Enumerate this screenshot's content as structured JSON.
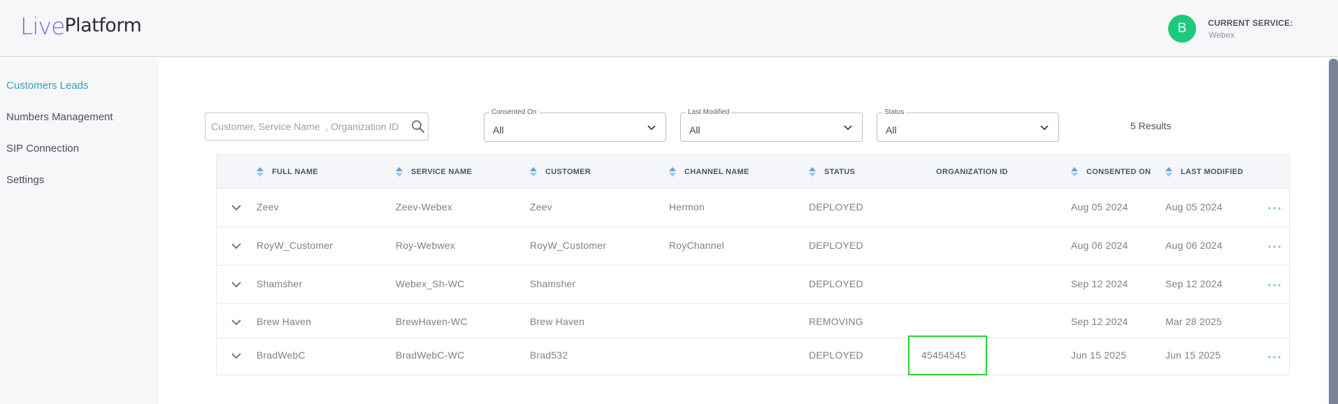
{
  "header": {
    "logo_live": "Live",
    "logo_platform": "Platform",
    "avatar_letter": "B",
    "service_label": "CURRENT SERVICE:",
    "service_value": "Webex"
  },
  "sidebar": {
    "items": [
      {
        "label": "Customers Leads",
        "active": true
      },
      {
        "label": "Numbers Management"
      },
      {
        "label": "SIP Connection"
      },
      {
        "label": "Settings"
      }
    ]
  },
  "filters": {
    "search_placeholder": "Customer, Service Name  , Organization ID",
    "consented_on": {
      "label": "Consented On",
      "value": "All"
    },
    "last_modified": {
      "label": "Last Modified",
      "value": "All"
    },
    "status": {
      "label": "Status",
      "value": "All"
    },
    "results": "5 Results"
  },
  "table": {
    "columns": [
      "FULL NAME",
      "SERVICE NAME",
      "CUSTOMER",
      "CHANNEL NAME",
      "STATUS",
      "ORGANIZATION ID",
      "CONSENTED ON",
      "LAST MODIFIED"
    ],
    "rows": [
      {
        "full_name": "Zeev",
        "service_name": "Zeev-Webex",
        "customer": "Zeev",
        "channel_name": "Hermon",
        "status": "DEPLOYED",
        "organization_id": "",
        "consented_on": "Aug 05 2024",
        "last_modified": "Aug 05 2024"
      },
      {
        "full_name": "RoyW_Customer",
        "service_name": "Roy-Webwex",
        "customer": "RoyW_Customer",
        "channel_name": "RoyChannel",
        "status": "DEPLOYED",
        "organization_id": "",
        "consented_on": "Aug 06 2024",
        "last_modified": "Aug 06 2024"
      },
      {
        "full_name": "Shamsher",
        "service_name": "Webex_Sh-WC",
        "customer": "Shamsher",
        "channel_name": "",
        "status": "DEPLOYED",
        "organization_id": "",
        "consented_on": "Sep 12 2024",
        "last_modified": "Sep 12 2024"
      },
      {
        "full_name": "Brew Haven",
        "service_name": "BrewHaven-WC",
        "customer": "Brew Haven",
        "channel_name": "",
        "status": "REMOVING",
        "organization_id": "",
        "consented_on": "Sep 12 2024",
        "last_modified": "Mar 28 2025"
      },
      {
        "full_name": "BradWebC",
        "service_name": "BradWebC-WC",
        "customer": "Brad532",
        "channel_name": "",
        "status": "DEPLOYED",
        "organization_id": "45454545",
        "consented_on": "Jun 15 2025",
        "last_modified": "Jun 15 2025"
      }
    ]
  },
  "colors": {
    "accent": "#2e9fbf",
    "avatar": "#1ec97c",
    "highlight": "#2fd131"
  },
  "icons": [
    "search-icon",
    "chevron-down-icon",
    "sort-icon",
    "expand-chevron-icon",
    "more-options-icon"
  ]
}
